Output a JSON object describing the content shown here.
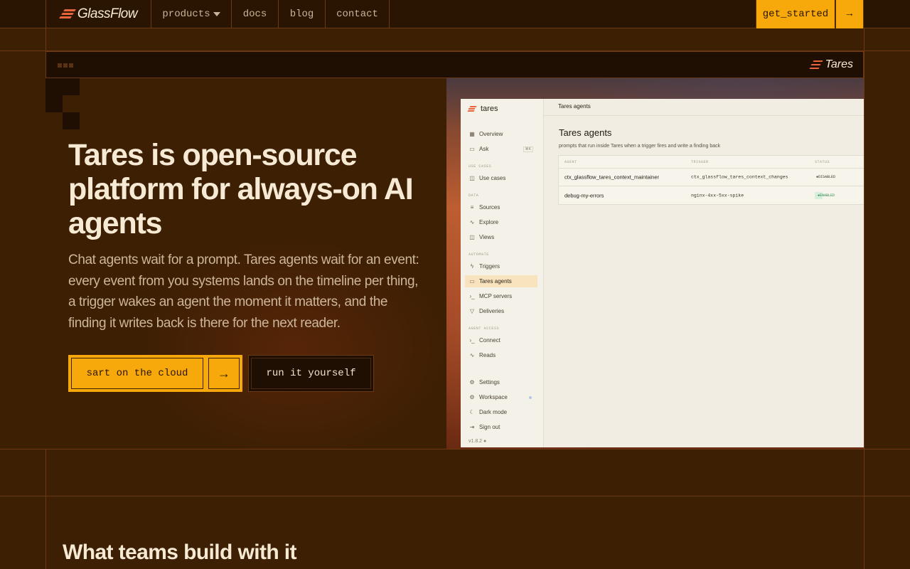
{
  "nav": {
    "brand": "GlassFlow",
    "links": [
      "products",
      "docs",
      "blog",
      "contact"
    ],
    "cta_label": "get_started",
    "cta_arrow": "→"
  },
  "hero": {
    "frame_brand": "Tares",
    "headline": "Tares is open-source platform for always-on AI agents",
    "subtitle": "Chat agents wait for a prompt. Tares agents wait for an event: every event from you systems lands on the timeline per thing, a trigger wakes an agent the moment it matters, and the finding it writes back is there for the next reader.",
    "primary_button": "sart on the cloud",
    "primary_arrow": "→",
    "secondary_button": "run it yourself"
  },
  "app": {
    "brand": "tares",
    "breadcrumb": "Tares agents",
    "sections": {
      "use_cases": "USE CASES",
      "data": "DATA",
      "automate": "AUTOMATE",
      "agent_access": "AGENT ACCESS"
    },
    "nav": {
      "overview": "Overview",
      "ask": "Ask",
      "ask_kbd": "⌘K",
      "use_cases": "Use cases",
      "sources": "Sources",
      "explore": "Explore",
      "views": "Views",
      "triggers": "Triggers",
      "tares_agents": "Tares agents",
      "mcp_servers": "MCP servers",
      "deliveries": "Deliveries",
      "connect": "Connect",
      "reads": "Reads",
      "settings": "Settings",
      "workspace": "Workspace",
      "dark_mode": "Dark mode",
      "sign_out": "Sign out"
    },
    "version": "v1.8.2",
    "page_title": "Tares agents",
    "page_description": "prompts that run inside Tares when a trigger fires and write a finding back",
    "table": {
      "headers": [
        "AGENT",
        "TRIGGER",
        "STATUS"
      ],
      "rows": [
        {
          "agent": "ctx_glassflow_tares_context_maintainer",
          "trigger": "ctx_glassflow_tares_context_changes",
          "status": "DISABLED"
        },
        {
          "agent": "debug-my-errors",
          "trigger": "nginx-4xx-5xx-spike",
          "status": "ENABLED"
        }
      ]
    }
  },
  "section2": {
    "title": "What teams build with it"
  },
  "colors": {
    "background": "#3d1f03",
    "accent": "#f7a90c",
    "brand_mark": "#e8643a"
  }
}
